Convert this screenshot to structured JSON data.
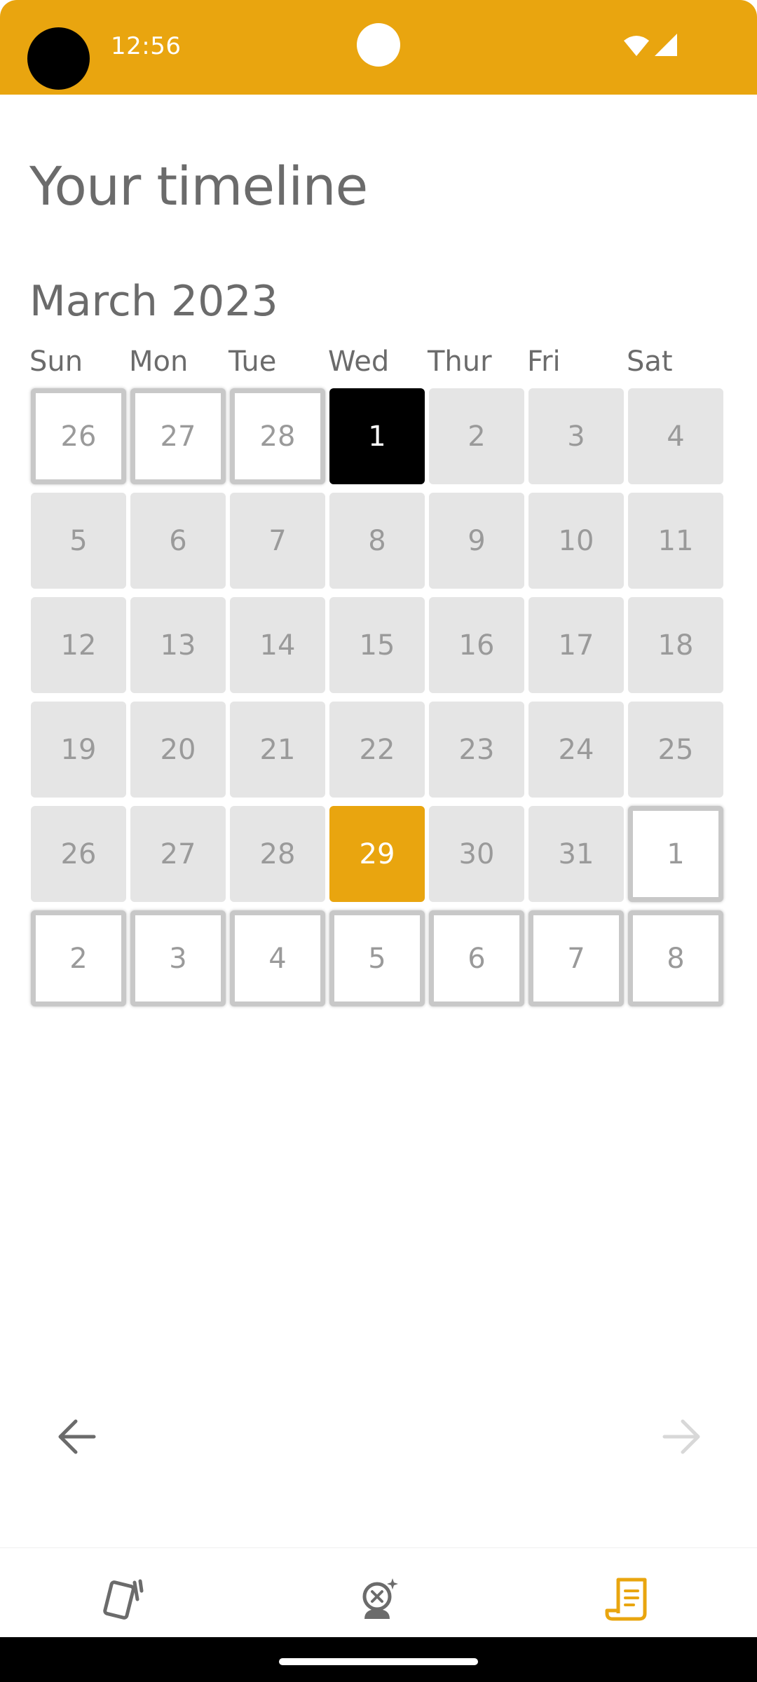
{
  "status_bar": {
    "time": "12:56",
    "color": "#E9A50F"
  },
  "page": {
    "title": "Your timeline",
    "month": "March 2023"
  },
  "weekdays": [
    "Sun",
    "Mon",
    "Tue",
    "Wed",
    "Thur",
    "Fri",
    "Sat"
  ],
  "calendar": {
    "weeks": [
      [
        {
          "day": "26",
          "state": "outside"
        },
        {
          "day": "27",
          "state": "outside"
        },
        {
          "day": "28",
          "state": "outside"
        },
        {
          "day": "1",
          "state": "start"
        },
        {
          "day": "2",
          "state": "normal"
        },
        {
          "day": "3",
          "state": "normal"
        },
        {
          "day": "4",
          "state": "normal"
        }
      ],
      [
        {
          "day": "5",
          "state": "normal"
        },
        {
          "day": "6",
          "state": "normal"
        },
        {
          "day": "7",
          "state": "normal"
        },
        {
          "day": "8",
          "state": "normal"
        },
        {
          "day": "9",
          "state": "normal"
        },
        {
          "day": "10",
          "state": "normal"
        },
        {
          "day": "11",
          "state": "normal"
        }
      ],
      [
        {
          "day": "12",
          "state": "normal"
        },
        {
          "day": "13",
          "state": "normal"
        },
        {
          "day": "14",
          "state": "normal"
        },
        {
          "day": "15",
          "state": "normal"
        },
        {
          "day": "16",
          "state": "normal"
        },
        {
          "day": "17",
          "state": "normal"
        },
        {
          "day": "18",
          "state": "normal"
        }
      ],
      [
        {
          "day": "19",
          "state": "normal"
        },
        {
          "day": "20",
          "state": "normal"
        },
        {
          "day": "21",
          "state": "normal"
        },
        {
          "day": "22",
          "state": "normal"
        },
        {
          "day": "23",
          "state": "normal"
        },
        {
          "day": "24",
          "state": "normal"
        },
        {
          "day": "25",
          "state": "normal"
        }
      ],
      [
        {
          "day": "26",
          "state": "normal"
        },
        {
          "day": "27",
          "state": "normal"
        },
        {
          "day": "28",
          "state": "normal"
        },
        {
          "day": "29",
          "state": "today"
        },
        {
          "day": "30",
          "state": "normal"
        },
        {
          "day": "31",
          "state": "normal"
        },
        {
          "day": "1",
          "state": "outside"
        }
      ],
      [
        {
          "day": "2",
          "state": "outside"
        },
        {
          "day": "3",
          "state": "outside"
        },
        {
          "day": "4",
          "state": "outside"
        },
        {
          "day": "5",
          "state": "outside"
        },
        {
          "day": "6",
          "state": "outside"
        },
        {
          "day": "7",
          "state": "outside"
        },
        {
          "day": "8",
          "state": "outside"
        }
      ]
    ]
  },
  "navigation": {
    "prev_icon": "arrow-left-icon",
    "next_icon": "arrow-right-icon",
    "next_enabled": false
  },
  "bottom_nav": {
    "tabs": [
      {
        "icon": "cards-icon",
        "active": false
      },
      {
        "icon": "reflection-icon",
        "active": false
      },
      {
        "icon": "scroll-icon",
        "active": true
      }
    ],
    "active_color": "#E9A50F",
    "inactive_color": "#6b6b6b"
  }
}
